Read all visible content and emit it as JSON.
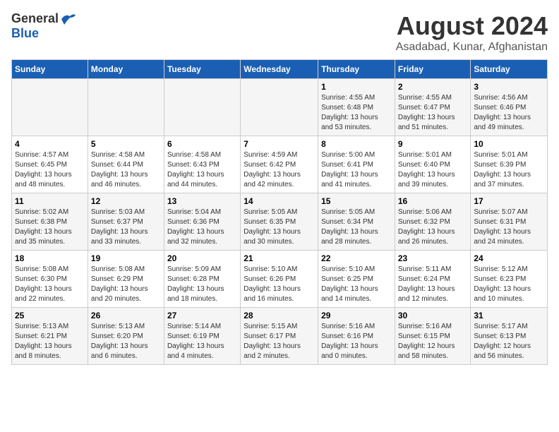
{
  "logo": {
    "general": "General",
    "blue": "Blue"
  },
  "title": "August 2024",
  "subtitle": "Asadabad, Kunar, Afghanistan",
  "days_of_week": [
    "Sunday",
    "Monday",
    "Tuesday",
    "Wednesday",
    "Thursday",
    "Friday",
    "Saturday"
  ],
  "weeks": [
    [
      {
        "day": "",
        "info": ""
      },
      {
        "day": "",
        "info": ""
      },
      {
        "day": "",
        "info": ""
      },
      {
        "day": "",
        "info": ""
      },
      {
        "day": "1",
        "info": "Sunrise: 4:55 AM\nSunset: 6:48 PM\nDaylight: 13 hours\nand 53 minutes."
      },
      {
        "day": "2",
        "info": "Sunrise: 4:55 AM\nSunset: 6:47 PM\nDaylight: 13 hours\nand 51 minutes."
      },
      {
        "day": "3",
        "info": "Sunrise: 4:56 AM\nSunset: 6:46 PM\nDaylight: 13 hours\nand 49 minutes."
      }
    ],
    [
      {
        "day": "4",
        "info": "Sunrise: 4:57 AM\nSunset: 6:45 PM\nDaylight: 13 hours\nand 48 minutes."
      },
      {
        "day": "5",
        "info": "Sunrise: 4:58 AM\nSunset: 6:44 PM\nDaylight: 13 hours\nand 46 minutes."
      },
      {
        "day": "6",
        "info": "Sunrise: 4:58 AM\nSunset: 6:43 PM\nDaylight: 13 hours\nand 44 minutes."
      },
      {
        "day": "7",
        "info": "Sunrise: 4:59 AM\nSunset: 6:42 PM\nDaylight: 13 hours\nand 42 minutes."
      },
      {
        "day": "8",
        "info": "Sunrise: 5:00 AM\nSunset: 6:41 PM\nDaylight: 13 hours\nand 41 minutes."
      },
      {
        "day": "9",
        "info": "Sunrise: 5:01 AM\nSunset: 6:40 PM\nDaylight: 13 hours\nand 39 minutes."
      },
      {
        "day": "10",
        "info": "Sunrise: 5:01 AM\nSunset: 6:39 PM\nDaylight: 13 hours\nand 37 minutes."
      }
    ],
    [
      {
        "day": "11",
        "info": "Sunrise: 5:02 AM\nSunset: 6:38 PM\nDaylight: 13 hours\nand 35 minutes."
      },
      {
        "day": "12",
        "info": "Sunrise: 5:03 AM\nSunset: 6:37 PM\nDaylight: 13 hours\nand 33 minutes."
      },
      {
        "day": "13",
        "info": "Sunrise: 5:04 AM\nSunset: 6:36 PM\nDaylight: 13 hours\nand 32 minutes."
      },
      {
        "day": "14",
        "info": "Sunrise: 5:05 AM\nSunset: 6:35 PM\nDaylight: 13 hours\nand 30 minutes."
      },
      {
        "day": "15",
        "info": "Sunrise: 5:05 AM\nSunset: 6:34 PM\nDaylight: 13 hours\nand 28 minutes."
      },
      {
        "day": "16",
        "info": "Sunrise: 5:06 AM\nSunset: 6:32 PM\nDaylight: 13 hours\nand 26 minutes."
      },
      {
        "day": "17",
        "info": "Sunrise: 5:07 AM\nSunset: 6:31 PM\nDaylight: 13 hours\nand 24 minutes."
      }
    ],
    [
      {
        "day": "18",
        "info": "Sunrise: 5:08 AM\nSunset: 6:30 PM\nDaylight: 13 hours\nand 22 minutes."
      },
      {
        "day": "19",
        "info": "Sunrise: 5:08 AM\nSunset: 6:29 PM\nDaylight: 13 hours\nand 20 minutes."
      },
      {
        "day": "20",
        "info": "Sunrise: 5:09 AM\nSunset: 6:28 PM\nDaylight: 13 hours\nand 18 minutes."
      },
      {
        "day": "21",
        "info": "Sunrise: 5:10 AM\nSunset: 6:26 PM\nDaylight: 13 hours\nand 16 minutes."
      },
      {
        "day": "22",
        "info": "Sunrise: 5:10 AM\nSunset: 6:25 PM\nDaylight: 13 hours\nand 14 minutes."
      },
      {
        "day": "23",
        "info": "Sunrise: 5:11 AM\nSunset: 6:24 PM\nDaylight: 13 hours\nand 12 minutes."
      },
      {
        "day": "24",
        "info": "Sunrise: 5:12 AM\nSunset: 6:23 PM\nDaylight: 13 hours\nand 10 minutes."
      }
    ],
    [
      {
        "day": "25",
        "info": "Sunrise: 5:13 AM\nSunset: 6:21 PM\nDaylight: 13 hours\nand 8 minutes."
      },
      {
        "day": "26",
        "info": "Sunrise: 5:13 AM\nSunset: 6:20 PM\nDaylight: 13 hours\nand 6 minutes."
      },
      {
        "day": "27",
        "info": "Sunrise: 5:14 AM\nSunset: 6:19 PM\nDaylight: 13 hours\nand 4 minutes."
      },
      {
        "day": "28",
        "info": "Sunrise: 5:15 AM\nSunset: 6:17 PM\nDaylight: 13 hours\nand 2 minutes."
      },
      {
        "day": "29",
        "info": "Sunrise: 5:16 AM\nSunset: 6:16 PM\nDaylight: 13 hours\nand 0 minutes."
      },
      {
        "day": "30",
        "info": "Sunrise: 5:16 AM\nSunset: 6:15 PM\nDaylight: 12 hours\nand 58 minutes."
      },
      {
        "day": "31",
        "info": "Sunrise: 5:17 AM\nSunset: 6:13 PM\nDaylight: 12 hours\nand 56 minutes."
      }
    ]
  ]
}
